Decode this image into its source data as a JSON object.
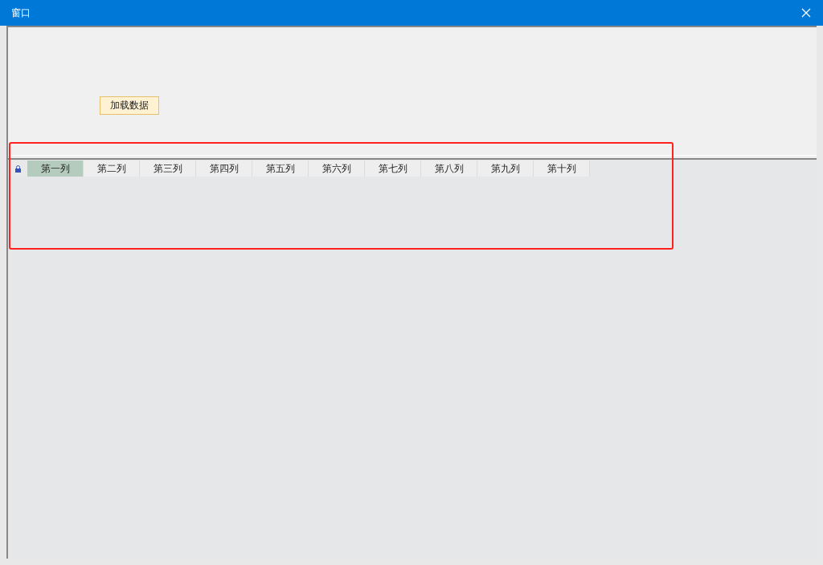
{
  "window": {
    "title": "窗口"
  },
  "load_button": {
    "label": "加载数据"
  },
  "grid": {
    "columns": [
      {
        "label": "第一列",
        "selected": true
      },
      {
        "label": "第二列",
        "selected": false
      },
      {
        "label": "第三列",
        "selected": false
      },
      {
        "label": "第四列",
        "selected": false
      },
      {
        "label": "第五列",
        "selected": false
      },
      {
        "label": "第六列",
        "selected": false
      },
      {
        "label": "第七列",
        "selected": false
      },
      {
        "label": "第八列",
        "selected": false
      },
      {
        "label": "第九列",
        "selected": false
      },
      {
        "label": "第十列",
        "selected": false
      }
    ]
  }
}
